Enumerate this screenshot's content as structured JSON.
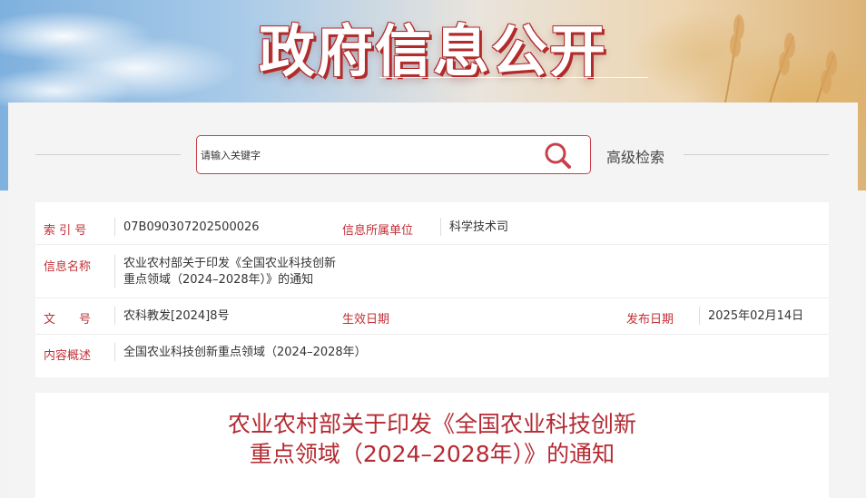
{
  "banner": {
    "title": "政府信息公开"
  },
  "search": {
    "placeholder": "请输入关键字",
    "advanced_label": "高级检索"
  },
  "meta": {
    "index_label": "索 引 号",
    "index_value": "07B090307202500026",
    "unit_label": "信息所属单位",
    "unit_value": "科学技术司",
    "name_label": "信息名称",
    "name_value_line1": "农业农村部关于印发《全国农业科技创新",
    "name_value_line2": "重点领域（2024–2028年）》的通知",
    "docno_label": "文　　号",
    "docno_value": "农科教发[2024]8号",
    "effective_label": "生效日期",
    "effective_value": "",
    "publish_label": "发布日期",
    "publish_value": "2025年02月14日",
    "summary_label": "内容概述",
    "summary_value": "全国农业科技创新重点领域（2024–2028年）"
  },
  "document": {
    "title_line1": "农业农村部关于印发《全国农业科技创新",
    "title_line2": "重点领域（2024–2028年）》的通知"
  },
  "colors": {
    "accent": "#c03036",
    "title_red": "#b42a32"
  },
  "icons": {
    "search": "search-icon"
  }
}
